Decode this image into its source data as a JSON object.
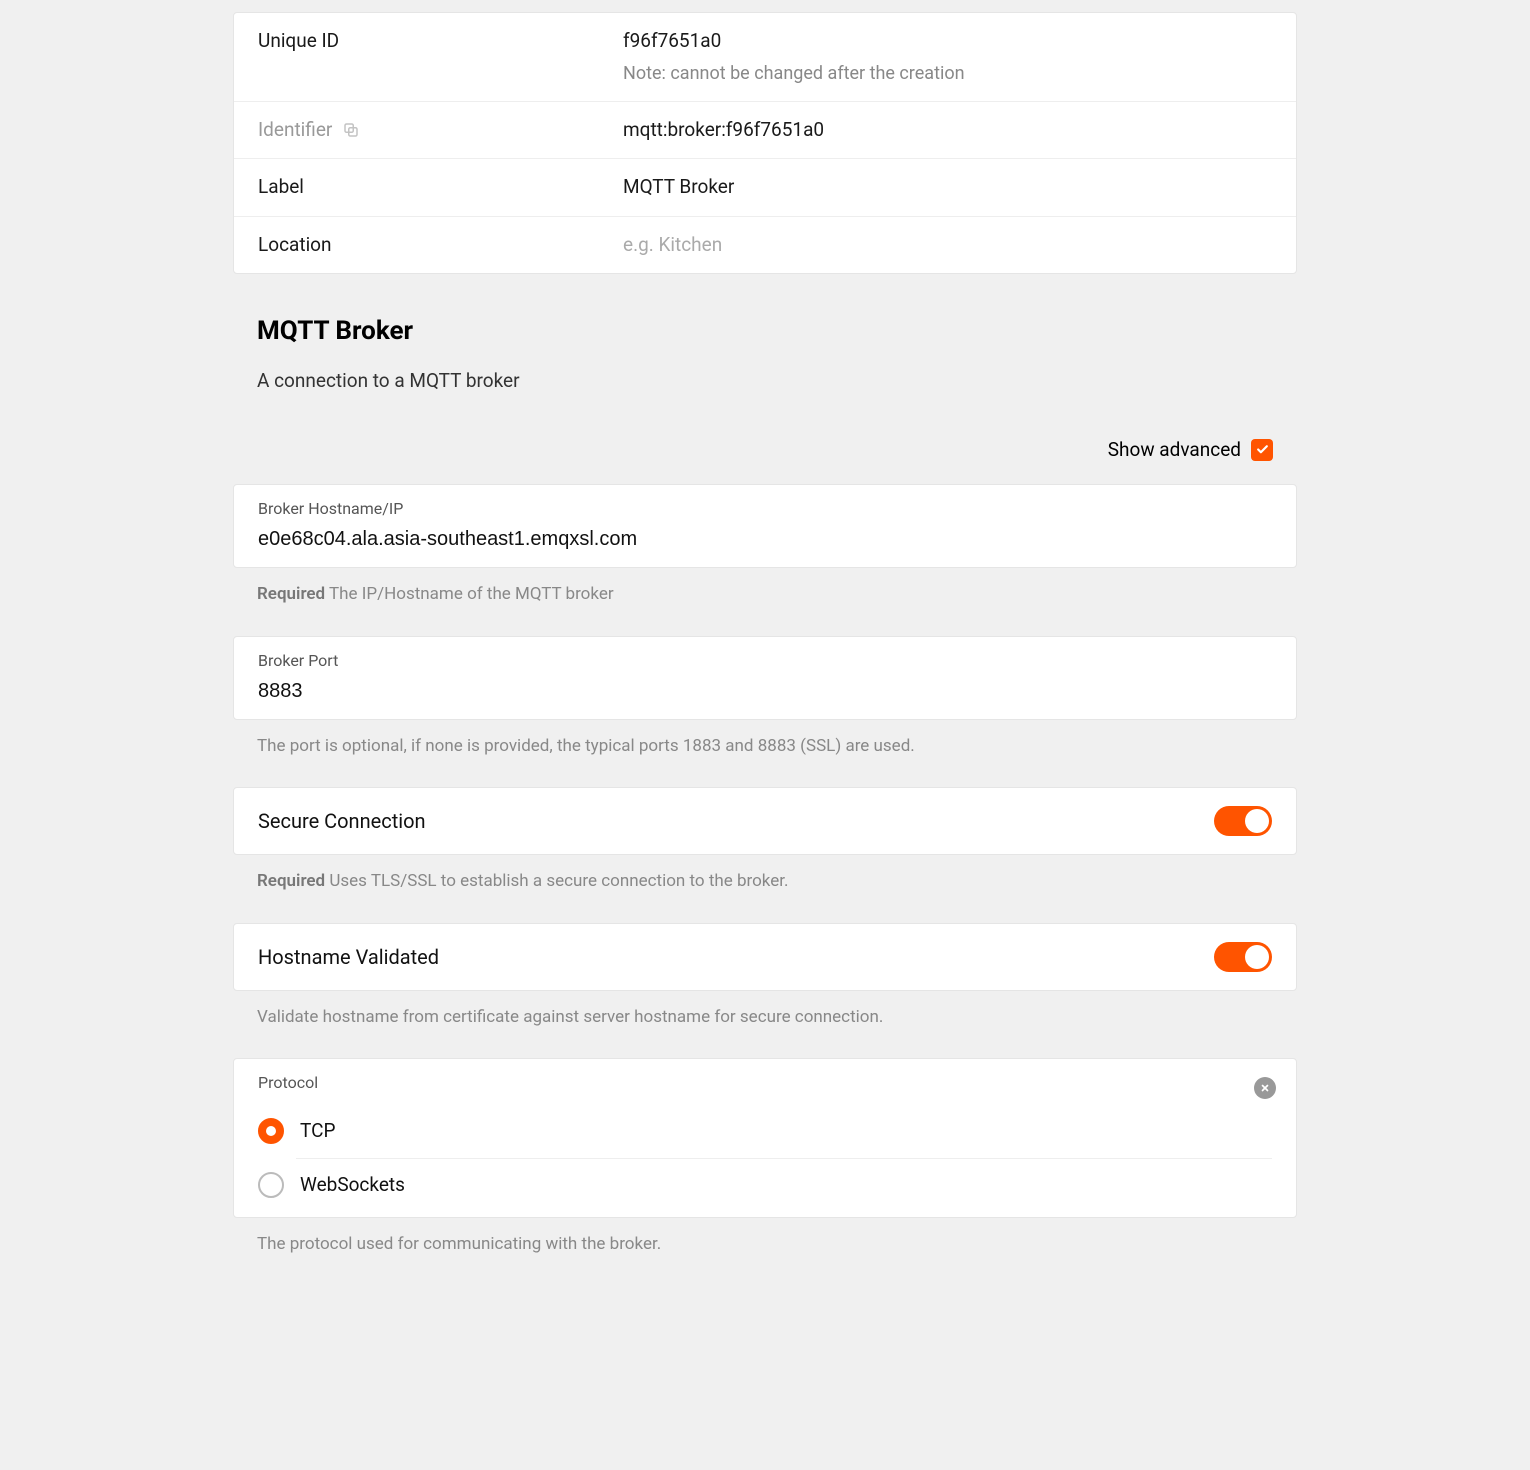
{
  "info": {
    "uniqueId": {
      "label": "Unique ID",
      "value": "f96f7651a0",
      "note": "Note: cannot be changed after the creation"
    },
    "identifier": {
      "label": "Identifier",
      "value": "mqtt:broker:f96f7651a0"
    },
    "labelField": {
      "label": "Label",
      "value": "MQTT Broker"
    },
    "location": {
      "label": "Location",
      "placeholder": "e.g. Kitchen"
    }
  },
  "section": {
    "title": "MQTT Broker",
    "subtitle": "A connection to a MQTT broker",
    "showAdvanced": "Show advanced"
  },
  "fields": {
    "hostname": {
      "label": "Broker Hostname/IP",
      "value": "e0e68c04.ala.asia-southeast1.emqxsl.com",
      "helpReq": "Required",
      "help": "The IP/Hostname of the MQTT broker"
    },
    "port": {
      "label": "Broker Port",
      "value": "8883",
      "help": "The port is optional, if none is provided, the typical ports 1883 and 8883 (SSL) are used."
    },
    "secure": {
      "label": "Secure Connection",
      "helpReq": "Required",
      "help": "Uses TLS/SSL to establish a secure connection to the broker."
    },
    "hostnameValidated": {
      "label": "Hostname Validated",
      "help": "Validate hostname from certificate against server hostname for secure connection."
    },
    "protocol": {
      "label": "Protocol",
      "options": {
        "tcp": "TCP",
        "ws": "WebSockets"
      },
      "help": "The protocol used for communicating with the broker."
    }
  }
}
